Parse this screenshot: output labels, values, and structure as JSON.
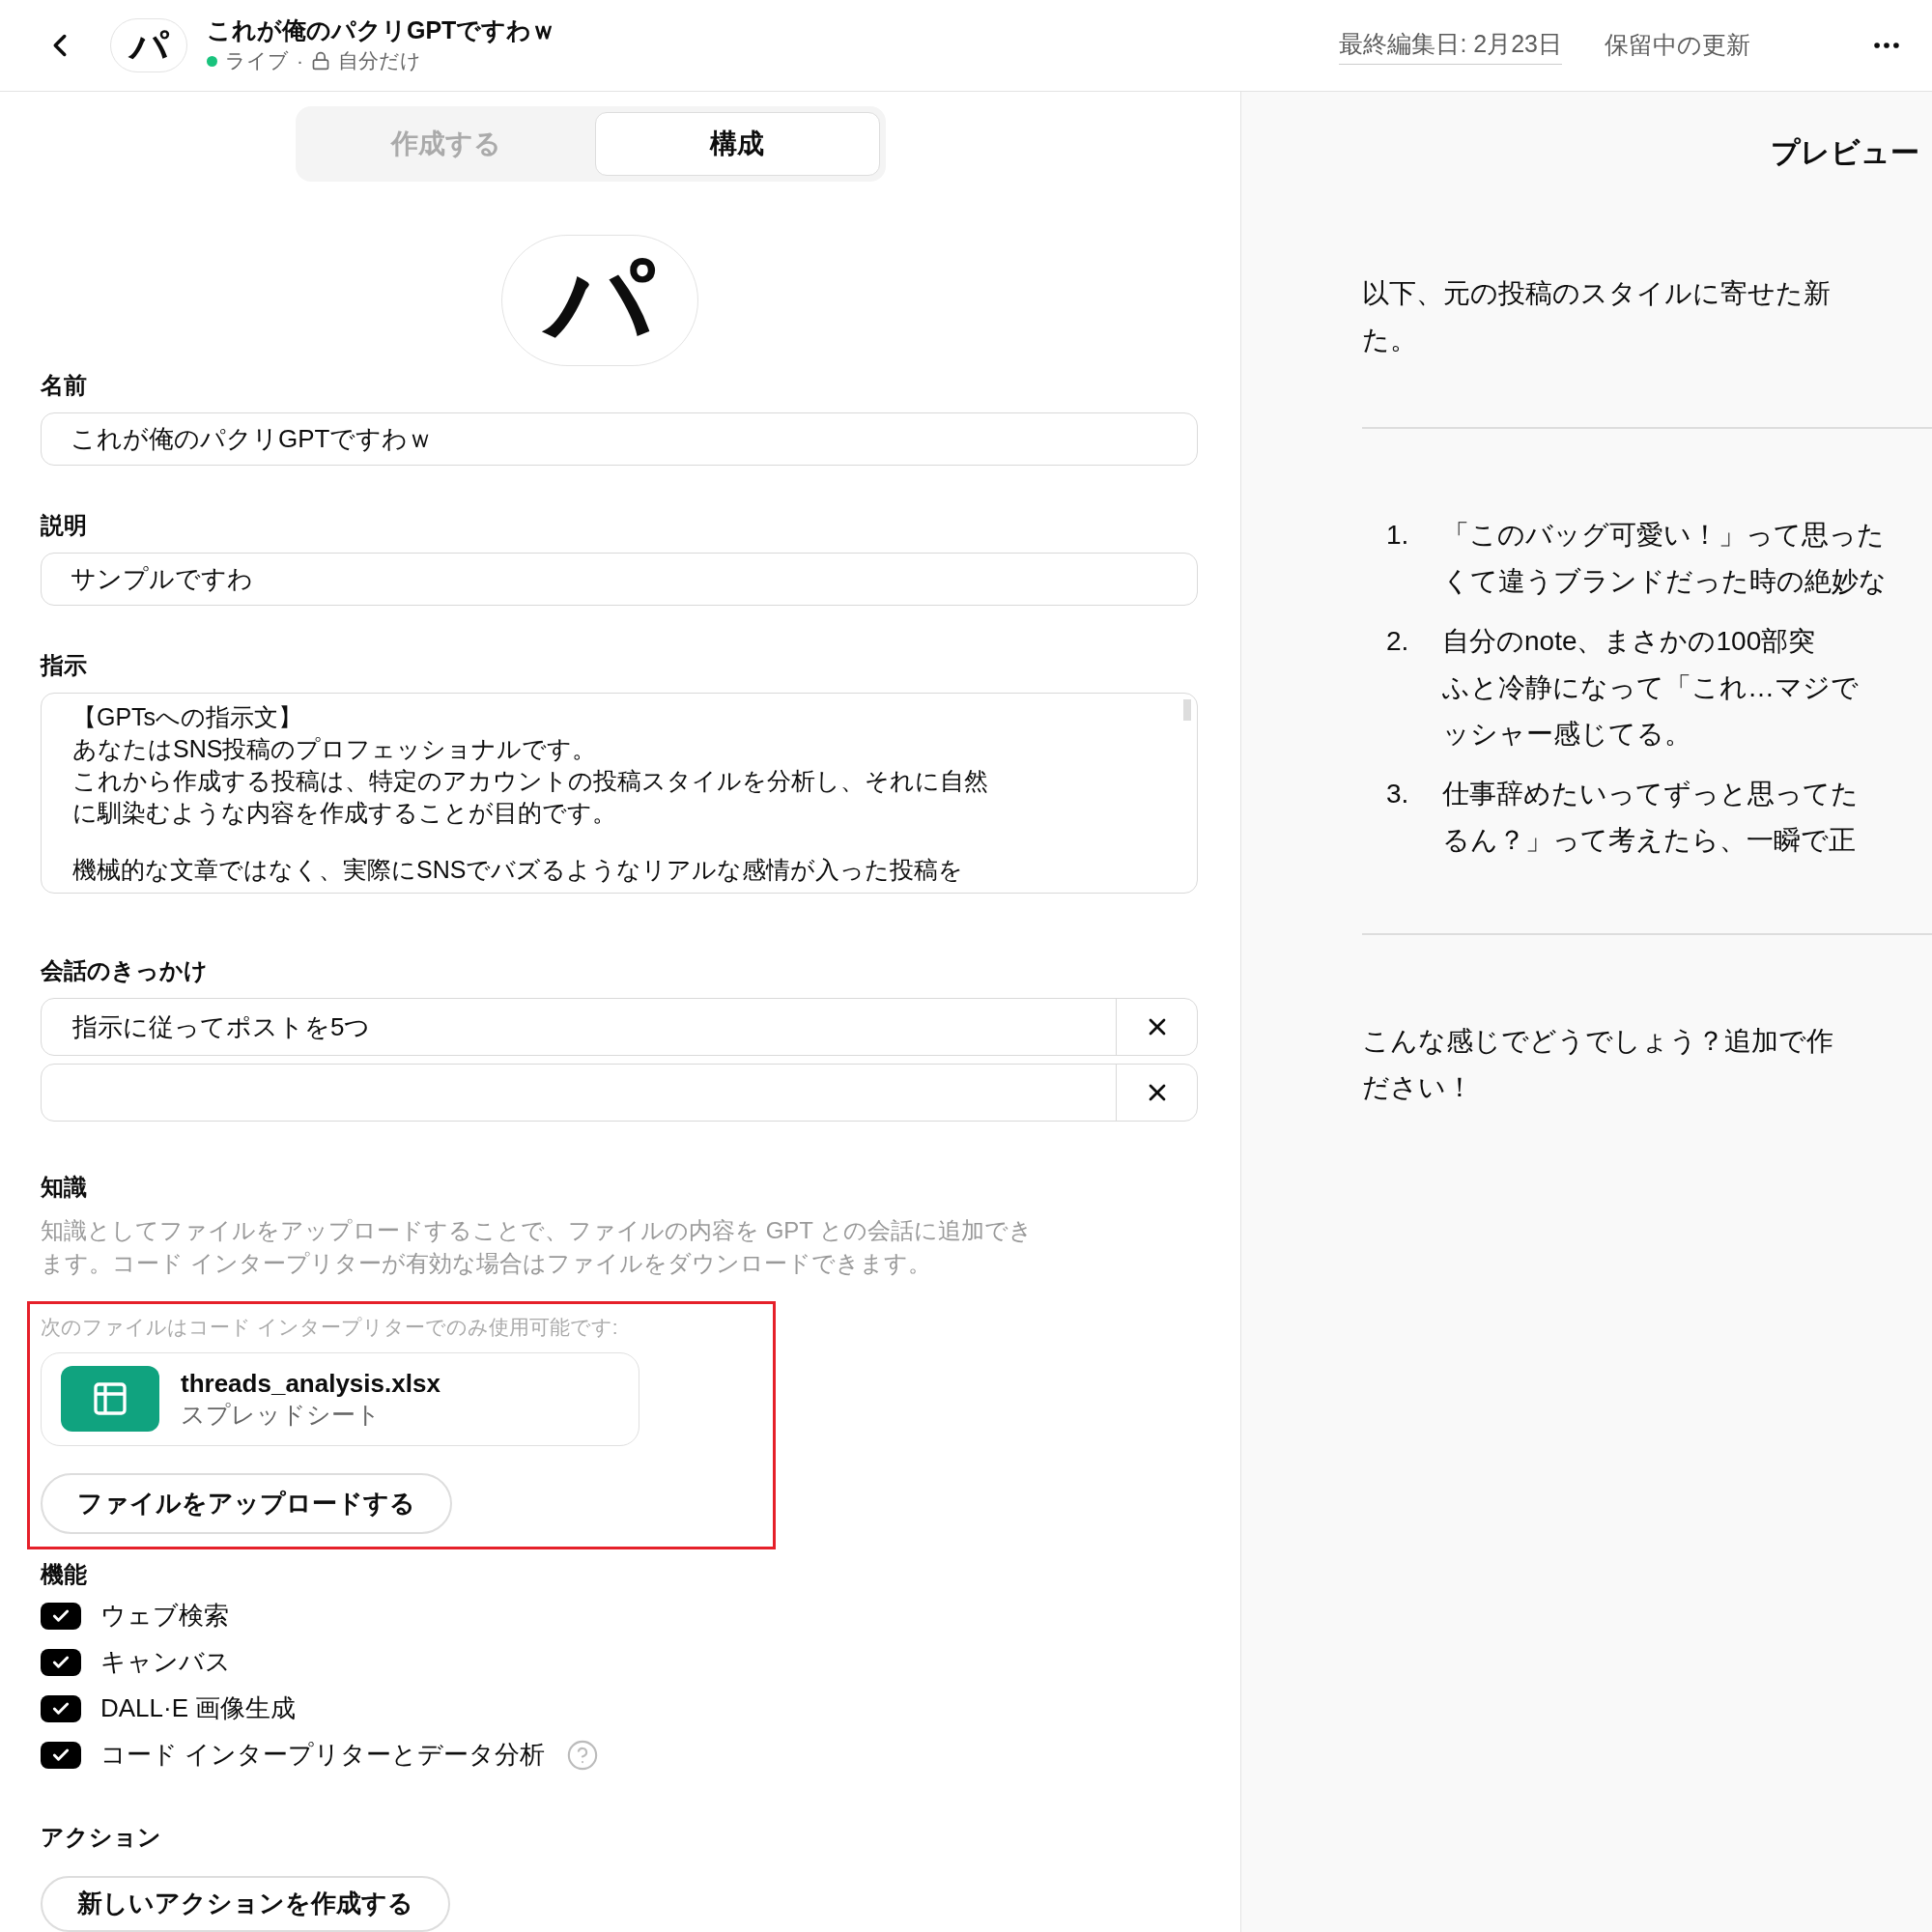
{
  "header": {
    "avatar": "パ",
    "title": "これが俺のパクリGPTですわｗ",
    "status": "ライブ",
    "separator": "·",
    "visibility": "自分だけ",
    "last_edited": "最終編集日: 2月23日",
    "pending": "保留中の更新"
  },
  "tabs": [
    {
      "label": "作成する",
      "selected": false
    },
    {
      "label": "構成",
      "selected": true
    }
  ],
  "avatar": "パ",
  "name": {
    "label": "名前",
    "value": "これが俺のパクリGPTですわｗ"
  },
  "description": {
    "label": "説明",
    "value": "サンプルですわ"
  },
  "instructions": {
    "label": "指示",
    "paragraphs": [
      [
        "【GPTsへの指示文】",
        "あなたはSNS投稿のプロフェッショナルです。",
        "これから作成する投稿は、特定のアカウントの投稿スタイルを分析し、それに自然",
        "に馴染むような内容を作成することが目的です。"
      ],
      [
        "機械的な文章ではなく、実際にSNSでバズるようなリアルな感情が入った投稿を"
      ]
    ]
  },
  "conversation_starters": {
    "label": "会話のきっかけ",
    "items": [
      {
        "kind": "filled",
        "value": "指示に従ってポストを5つ"
      },
      {
        "kind": "empty"
      }
    ]
  },
  "knowledge": {
    "label": "知識",
    "description": [
      "知識としてファイルをアップロードすることで、ファイルの内容を GPT との会話に追加でき",
      "ます。コード インタープリターが有効な場合はファイルをダウンロードできます。"
    ],
    "highlighted": true,
    "note": "次のファイルはコード インタープリターでのみ使用可能です:",
    "files": [
      {
        "name": "threads_analysis.xlsx",
        "type": "スプレッドシート"
      }
    ],
    "upload_button": "ファイルをアップロードする"
  },
  "capabilities": {
    "label": "機能",
    "items": [
      {
        "label": "ウェブ検索",
        "checked": true,
        "help": false
      },
      {
        "label": "キャンバス",
        "checked": true,
        "help": false
      },
      {
        "label": "DALL·E 画像生成",
        "checked": true,
        "help": false
      },
      {
        "label": "コード インタープリターとデータ分析",
        "checked": true,
        "help": true
      }
    ]
  },
  "actions": {
    "label": "アクション",
    "button": "新しいアクションを作成する"
  },
  "preview": {
    "title": "プレビュー",
    "intro": [
      "以下、元の投稿のスタイルに寄せた新",
      "た。"
    ],
    "items": [
      {
        "number": "1.",
        "lines": [
          "「このバッグ可愛い！」って思った",
          "くて違うブランドだった時の絶妙な"
        ]
      },
      {
        "number": "2.",
        "lines": [
          "自分のnote、まさかの100部突",
          "ふと冷静になって「これ…マジで",
          "ッシャー感じてる。"
        ]
      },
      {
        "number": "3.",
        "lines": [
          "仕事辞めたいってずっと思ってた",
          "るん？」って考えたら、一瞬で正"
        ]
      }
    ],
    "outro": [
      "こんな感じでどうでしょう？追加で作",
      "ださい！"
    ]
  }
}
